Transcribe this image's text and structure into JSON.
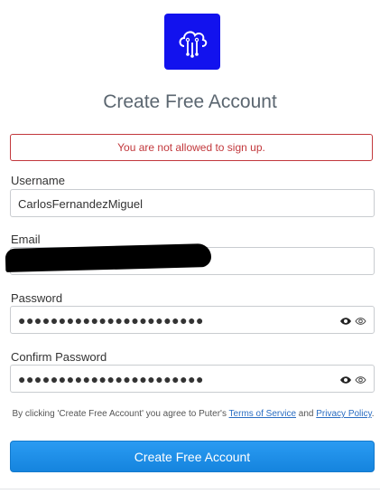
{
  "logo": {
    "icon": "cloud-circuit-icon",
    "color": "#1212ee"
  },
  "title": "Create Free Account",
  "error_message": "You are not allowed to sign up.",
  "username": {
    "label": "Username",
    "value": "CarlosFernandezMiguel"
  },
  "email": {
    "label": "Email"
  },
  "password": {
    "label": "Password",
    "masked": "●●●●●●●●●●●●●●●●●●●●●●●"
  },
  "confirm_password": {
    "label": "Confirm Password",
    "masked": "●●●●●●●●●●●●●●●●●●●●●●●"
  },
  "terms": {
    "prefix": "By clicking 'Create Free Account' you agree to Puter's ",
    "tos_link": "Terms of Service",
    "and": " and ",
    "privacy_link": "Privacy Policy",
    "suffix": "."
  },
  "submit_label": "Create Free Account"
}
